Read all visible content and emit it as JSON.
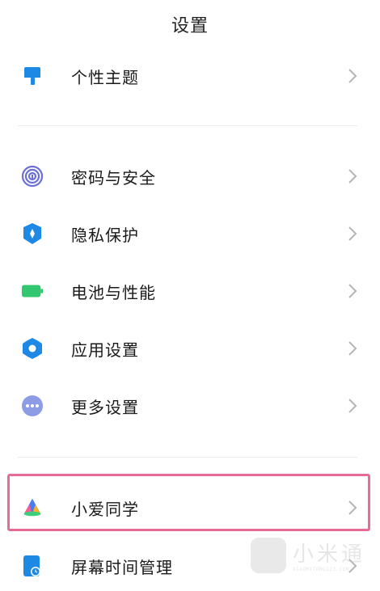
{
  "header": {
    "title": "设置"
  },
  "rows": [
    {
      "label": "个性主题",
      "icon": "paintbrush-icon"
    },
    {
      "label": "密码与安全",
      "icon": "fingerprint-icon"
    },
    {
      "label": "隐私保护",
      "icon": "privacy-shield-icon"
    },
    {
      "label": "电池与性能",
      "icon": "battery-icon"
    },
    {
      "label": "应用设置",
      "icon": "gear-icon"
    },
    {
      "label": "更多设置",
      "icon": "more-dots-icon"
    },
    {
      "label": "小爱同学",
      "icon": "xiaoai-icon",
      "highlighted": true
    },
    {
      "label": "屏幕时间管理",
      "icon": "screen-time-icon"
    }
  ],
  "watermark": {
    "text": "小米通",
    "sub": "XIAOMITONG123.COM"
  },
  "colors": {
    "brush": "#1e88e5",
    "fingerprint": "#6b6fd6",
    "shield": "#1e88e5",
    "battery": "#34c772",
    "gear": "#1e88e5",
    "more": "#8e9ce6",
    "highlight_border": "#e96b93",
    "chevron": "#b5b5b5"
  }
}
